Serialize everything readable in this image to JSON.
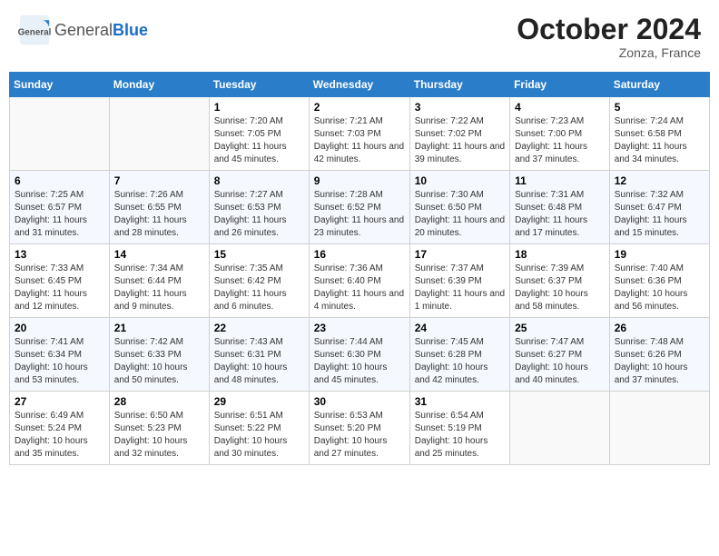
{
  "header": {
    "logo_general": "General",
    "logo_blue": "Blue",
    "month_title": "October 2024",
    "location": "Zonza, France"
  },
  "weekdays": [
    "Sunday",
    "Monday",
    "Tuesday",
    "Wednesday",
    "Thursday",
    "Friday",
    "Saturday"
  ],
  "weeks": [
    [
      null,
      null,
      {
        "day": 1,
        "sunrise": "7:20 AM",
        "sunset": "7:05 PM",
        "daylight": "11 hours and 45 minutes."
      },
      {
        "day": 2,
        "sunrise": "7:21 AM",
        "sunset": "7:03 PM",
        "daylight": "11 hours and 42 minutes."
      },
      {
        "day": 3,
        "sunrise": "7:22 AM",
        "sunset": "7:02 PM",
        "daylight": "11 hours and 39 minutes."
      },
      {
        "day": 4,
        "sunrise": "7:23 AM",
        "sunset": "7:00 PM",
        "daylight": "11 hours and 37 minutes."
      },
      {
        "day": 5,
        "sunrise": "7:24 AM",
        "sunset": "6:58 PM",
        "daylight": "11 hours and 34 minutes."
      }
    ],
    [
      {
        "day": 6,
        "sunrise": "7:25 AM",
        "sunset": "6:57 PM",
        "daylight": "11 hours and 31 minutes."
      },
      {
        "day": 7,
        "sunrise": "7:26 AM",
        "sunset": "6:55 PM",
        "daylight": "11 hours and 28 minutes."
      },
      {
        "day": 8,
        "sunrise": "7:27 AM",
        "sunset": "6:53 PM",
        "daylight": "11 hours and 26 minutes."
      },
      {
        "day": 9,
        "sunrise": "7:28 AM",
        "sunset": "6:52 PM",
        "daylight": "11 hours and 23 minutes."
      },
      {
        "day": 10,
        "sunrise": "7:30 AM",
        "sunset": "6:50 PM",
        "daylight": "11 hours and 20 minutes."
      },
      {
        "day": 11,
        "sunrise": "7:31 AM",
        "sunset": "6:48 PM",
        "daylight": "11 hours and 17 minutes."
      },
      {
        "day": 12,
        "sunrise": "7:32 AM",
        "sunset": "6:47 PM",
        "daylight": "11 hours and 15 minutes."
      }
    ],
    [
      {
        "day": 13,
        "sunrise": "7:33 AM",
        "sunset": "6:45 PM",
        "daylight": "11 hours and 12 minutes."
      },
      {
        "day": 14,
        "sunrise": "7:34 AM",
        "sunset": "6:44 PM",
        "daylight": "11 hours and 9 minutes."
      },
      {
        "day": 15,
        "sunrise": "7:35 AM",
        "sunset": "6:42 PM",
        "daylight": "11 hours and 6 minutes."
      },
      {
        "day": 16,
        "sunrise": "7:36 AM",
        "sunset": "6:40 PM",
        "daylight": "11 hours and 4 minutes."
      },
      {
        "day": 17,
        "sunrise": "7:37 AM",
        "sunset": "6:39 PM",
        "daylight": "11 hours and 1 minute."
      },
      {
        "day": 18,
        "sunrise": "7:39 AM",
        "sunset": "6:37 PM",
        "daylight": "10 hours and 58 minutes."
      },
      {
        "day": 19,
        "sunrise": "7:40 AM",
        "sunset": "6:36 PM",
        "daylight": "10 hours and 56 minutes."
      }
    ],
    [
      {
        "day": 20,
        "sunrise": "7:41 AM",
        "sunset": "6:34 PM",
        "daylight": "10 hours and 53 minutes."
      },
      {
        "day": 21,
        "sunrise": "7:42 AM",
        "sunset": "6:33 PM",
        "daylight": "10 hours and 50 minutes."
      },
      {
        "day": 22,
        "sunrise": "7:43 AM",
        "sunset": "6:31 PM",
        "daylight": "10 hours and 48 minutes."
      },
      {
        "day": 23,
        "sunrise": "7:44 AM",
        "sunset": "6:30 PM",
        "daylight": "10 hours and 45 minutes."
      },
      {
        "day": 24,
        "sunrise": "7:45 AM",
        "sunset": "6:28 PM",
        "daylight": "10 hours and 42 minutes."
      },
      {
        "day": 25,
        "sunrise": "7:47 AM",
        "sunset": "6:27 PM",
        "daylight": "10 hours and 40 minutes."
      },
      {
        "day": 26,
        "sunrise": "7:48 AM",
        "sunset": "6:26 PM",
        "daylight": "10 hours and 37 minutes."
      }
    ],
    [
      {
        "day": 27,
        "sunrise": "6:49 AM",
        "sunset": "5:24 PM",
        "daylight": "10 hours and 35 minutes."
      },
      {
        "day": 28,
        "sunrise": "6:50 AM",
        "sunset": "5:23 PM",
        "daylight": "10 hours and 32 minutes."
      },
      {
        "day": 29,
        "sunrise": "6:51 AM",
        "sunset": "5:22 PM",
        "daylight": "10 hours and 30 minutes."
      },
      {
        "day": 30,
        "sunrise": "6:53 AM",
        "sunset": "5:20 PM",
        "daylight": "10 hours and 27 minutes."
      },
      {
        "day": 31,
        "sunrise": "6:54 AM",
        "sunset": "5:19 PM",
        "daylight": "10 hours and 25 minutes."
      },
      null,
      null
    ]
  ]
}
